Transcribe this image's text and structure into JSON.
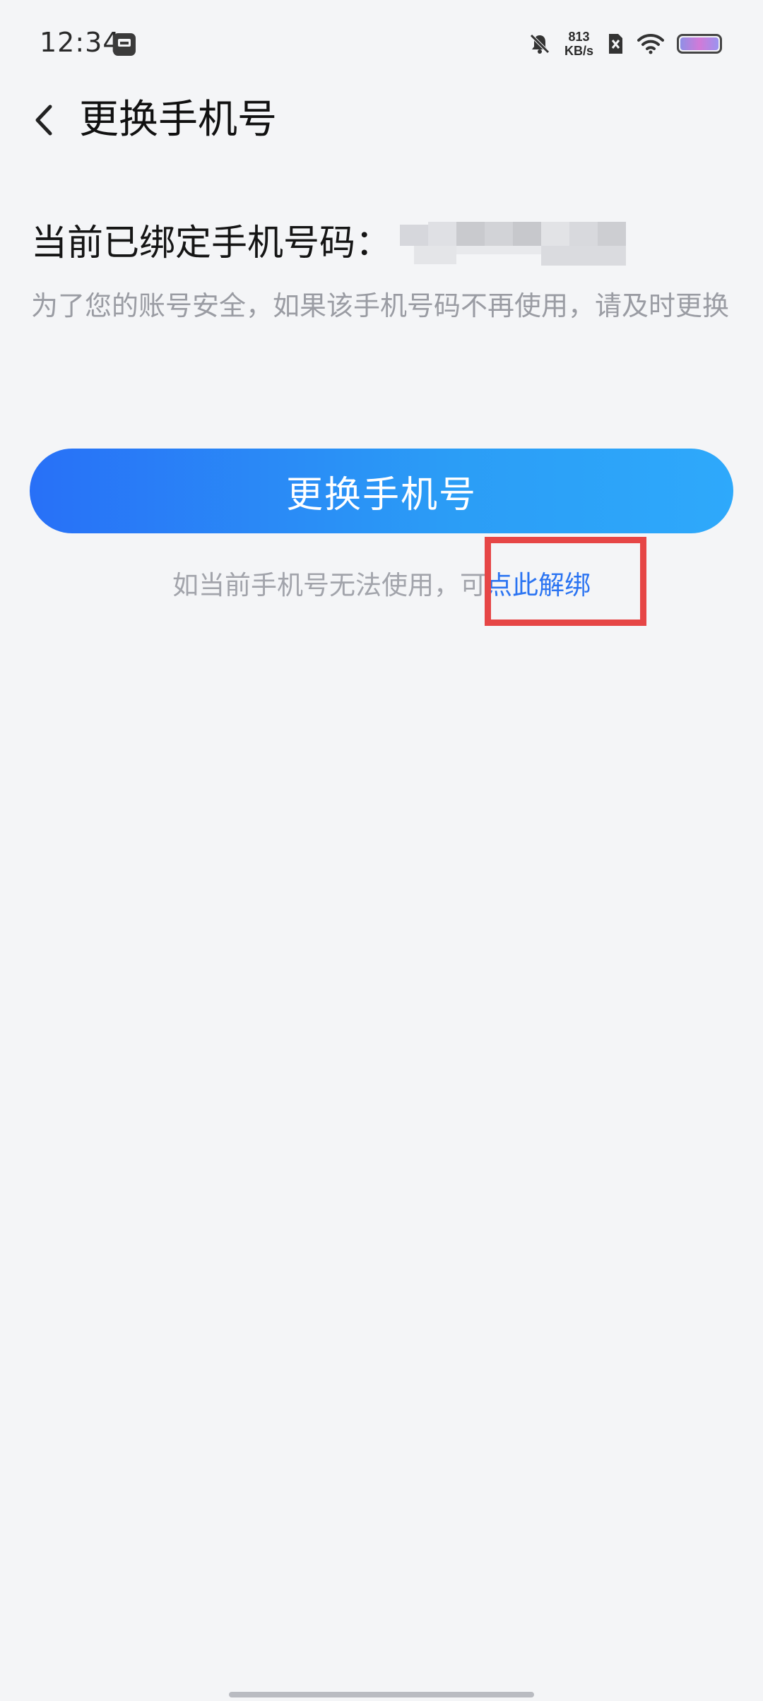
{
  "status_bar": {
    "time": "12:34",
    "net_speed_value": "813",
    "net_speed_unit": "KB/s",
    "battery_level": 1.0,
    "icons": [
      "app-notification-icon",
      "mute-bell-icon",
      "no-sim-icon",
      "wifi-icon",
      "battery-icon"
    ]
  },
  "header": {
    "title": "更换手机号",
    "back_icon": "back-chevron-icon"
  },
  "content": {
    "bound_label": "当前已绑定手机号码：",
    "hint": "为了您的账号安全，如果该手机号码不再使用，请及时更换",
    "change_button_label": "更换手机号",
    "unbind_prefix": "如当前手机号无法使用，可",
    "unbind_link": "点此解绑"
  },
  "colors": {
    "button_gradient_start": "#2870f7",
    "button_gradient_end": "#2ea9fb",
    "link": "#2b74f2",
    "highlight_box": "#e64646",
    "background": "#f4f5f7"
  }
}
